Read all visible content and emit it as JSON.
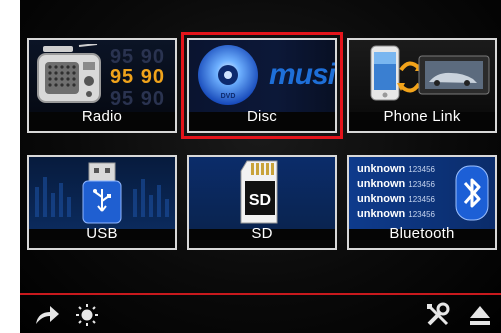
{
  "tiles": {
    "radio": {
      "label": "Radio",
      "freq_top": "95 90",
      "freq_mid": "95 90",
      "freq_bot": "95 90"
    },
    "disc": {
      "label": "Disc",
      "music_text": "music",
      "dvd_text": "DVD"
    },
    "phone_link": {
      "label": "Phone Link"
    },
    "usb": {
      "label": "USB"
    },
    "sd": {
      "label": "SD",
      "card_text": "SD"
    },
    "bluetooth": {
      "label": "Bluetooth",
      "rows": [
        {
          "name": "unknown",
          "number": "123456"
        },
        {
          "name": "unknown",
          "number": "123456"
        },
        {
          "name": "unknown",
          "number": "123456"
        },
        {
          "name": "unknown",
          "number": "123456"
        }
      ]
    }
  },
  "selected_tile": "Disc",
  "bottom_bar": {
    "back_icon": "arrow-right-icon",
    "brightness_icon": "sun-icon",
    "settings_icon": "tools-icon",
    "eject_icon": "eject-icon"
  },
  "colors": {
    "selection_outline": "#e4141b",
    "accent_line": "#c8191d",
    "tile_border": "#d8d8d8",
    "frequency_active": "#f0a31b"
  }
}
